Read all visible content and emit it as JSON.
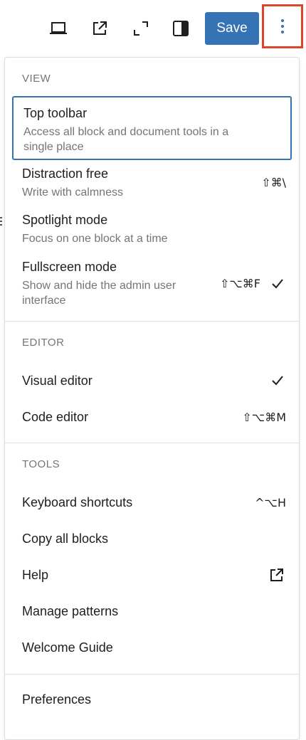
{
  "toolbar": {
    "icons": [
      "device-preview-icon",
      "external-link-icon",
      "fullscreen-icon",
      "sidebar-toggle-icon"
    ],
    "save_label": "Save",
    "more_icon": "vertical-ellipsis-icon",
    "accent": "#3673b4",
    "highlight": "#d9462c"
  },
  "menu": {
    "view": {
      "label": "VIEW",
      "items": [
        {
          "title": "Top toolbar",
          "desc": "Access all block and document tools in a single place"
        },
        {
          "title": "Distraction free",
          "desc": "Write with calmness",
          "shortcut": "⇧⌘\\"
        },
        {
          "title": "Spotlight mode",
          "desc": "Focus on one block at a time"
        },
        {
          "title": "Fullscreen mode",
          "desc": "Show and hide the admin user interface",
          "shortcut": "⇧⌥⌘F",
          "checked": true
        }
      ]
    },
    "editor": {
      "label": "EDITOR",
      "items": [
        {
          "title": "Visual editor",
          "checked": true
        },
        {
          "title": "Code editor",
          "shortcut": "⇧⌥⌘M"
        }
      ]
    },
    "tools": {
      "label": "TOOLS",
      "items": [
        {
          "title": "Keyboard shortcuts",
          "shortcut": "^⌥H"
        },
        {
          "title": "Copy all blocks"
        },
        {
          "title": "Help",
          "icon": "external-link-icon"
        },
        {
          "title": "Manage patterns"
        },
        {
          "title": "Welcome Guide"
        }
      ]
    },
    "preferences": {
      "title": "Preferences"
    }
  }
}
